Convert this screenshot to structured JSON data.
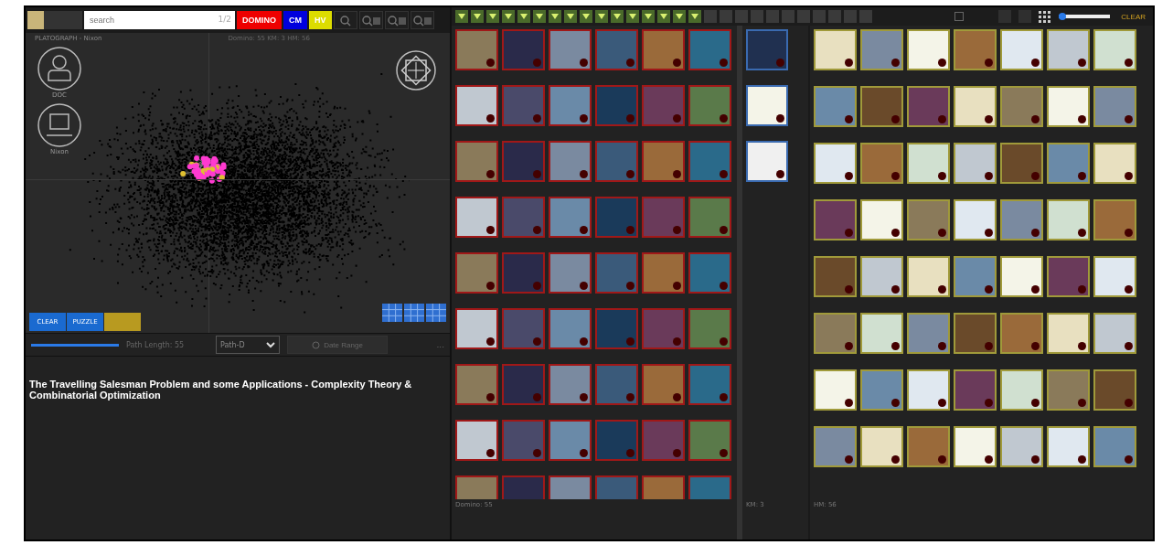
{
  "left_panel": {
    "search": {
      "placeholder": "search",
      "counter": "1/2"
    },
    "mode_buttons": [
      {
        "label": "DOMINO",
        "kind": "red"
      },
      {
        "label": "CM",
        "kind": "blue"
      },
      {
        "label": "HV",
        "kind": "yellow"
      }
    ],
    "plot": {
      "title": "PLATOGRAPH - Nixon",
      "counts": "Domino: 55   KM: 3   HM: 56",
      "avatars": [
        {
          "label": "DOC"
        },
        {
          "label": "Nixon"
        }
      ]
    },
    "action_buttons": [
      {
        "label": "CLEAR",
        "kind": "blue"
      },
      {
        "label": "PUZZLE",
        "kind": "blue"
      },
      {
        "kind": "yellow"
      }
    ],
    "path_slider": {
      "level": 1.0,
      "reading": "Path Length: 55"
    },
    "path_select": {
      "value": "Path-D"
    },
    "date_range": {
      "label": "Date Range"
    },
    "more": "...",
    "title": "The Travelling Salesman Problem and some Applications - Complexity Theory & Combinatorial Optimization"
  },
  "toolbar": {
    "path_slots": [
      {
        "filled": true
      },
      {
        "filled": true
      },
      {
        "filled": true
      },
      {
        "filled": true
      },
      {
        "filled": true
      },
      {
        "filled": true
      },
      {
        "filled": true
      },
      {
        "filled": true
      },
      {
        "filled": true
      },
      {
        "filled": true
      },
      {
        "filled": true
      },
      {
        "filled": true
      },
      {
        "filled": true
      },
      {
        "filled": true
      },
      {
        "filled": true
      },
      {
        "filled": true
      },
      {
        "filled": false
      },
      {
        "filled": false
      },
      {
        "filled": false
      },
      {
        "filled": false
      },
      {
        "filled": false
      },
      {
        "filled": false
      },
      {
        "filled": false
      },
      {
        "filled": false
      },
      {
        "filled": false
      },
      {
        "filled": false
      },
      {
        "filled": false
      }
    ],
    "filter_box": {
      "checked": false
    },
    "size_slider": {
      "level": 0.05
    },
    "clear": "CLEAR"
  },
  "domino": {
    "status": "Domino: 55"
  },
  "km": {
    "status": "KM: 3"
  },
  "hm": {
    "status": "HM: 56"
  }
}
